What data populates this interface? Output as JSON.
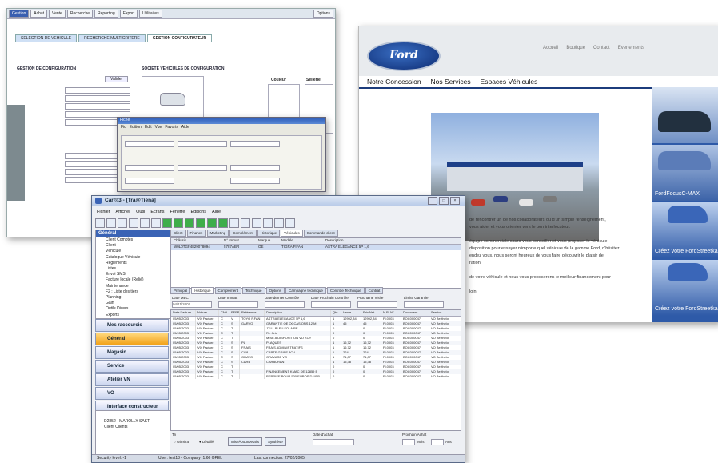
{
  "back_window": {
    "menu": [
      "Gestion",
      "Achat",
      "Vente",
      "Recherche",
      "Reporting",
      "Export",
      "Utilitaires",
      "Options"
    ],
    "tabs": [
      "SELECTION DE VEHICULE",
      "RECHERCHE MULTICRITERE",
      "GESTION CONFIGURATEUR"
    ],
    "sections": {
      "left": "GESTION DE CONFIGURATION",
      "right": "SOCIETE VEHICULES DE CONFIGURATION"
    },
    "columns": [
      "Couleur",
      "Sellerie"
    ],
    "button": "Valider"
  },
  "popup_window": {
    "title": "Fiche",
    "menu": [
      "Fic",
      "Edition",
      "Edit",
      "Vue",
      "Favoris",
      "Aide"
    ]
  },
  "ford_site": {
    "logo": "Ford",
    "top_nav": [
      "Accueil",
      "Boutique",
      "Contact",
      "Evenements"
    ],
    "nav": [
      "Notre Concession",
      "Nos Services",
      "Espaces Véhicules"
    ],
    "side_cards": [
      "",
      "FordFocusC-MAX",
      "Créez votre FordStreetka",
      "Créez votre FordStreetka"
    ],
    "text_lines": [
      "de rencontrer un de nos collaborateurs ou d'un simple renseignement,",
      "vous aider et vous orienter vers le bon interlocuteur.",
      "",
      "équipe commerciale saura vous conseiller et vous proposer le véhicule",
      "disposition pour essayer n'importe quel véhicule de la gamme Ford, n'hésitez",
      "endez vous, nous seront heureux de vous faire découvrir le plaisir de",
      "ration.",
      "",
      "de votre véhicule et nous vous proposerons le meilleur financement pour",
      "",
      "loin."
    ]
  },
  "main_window": {
    "title": "Car@3 - [Tra@Tiena]",
    "menu": [
      "Fichier",
      "Afficher",
      "Outil",
      "Ecrans",
      "Fenêtre",
      "Editions",
      "Aide"
    ],
    "tree_header": "Général",
    "tree_items": [
      "Client Comptes",
      "Client",
      "Véhicule",
      "Catalogue Véhicule",
      "Règlements",
      "Listes",
      "Envoi SMS",
      "Facture locale (Relié)",
      "Maintenance",
      "F2 : Liste des tiers",
      "Planning",
      "Gain",
      "Outils Divers",
      "Exports"
    ],
    "nav_buttons": [
      "Mes raccourcis",
      "Général",
      "Magasin",
      "Service",
      "Atelier VN",
      "VO",
      "Interface constructeur"
    ],
    "nav_bottom_items": [
      "D2852 - MAROLLY SAST",
      "Client Clients"
    ],
    "top_tabs": [
      "Client",
      "Finance",
      "Marketing",
      "Complément",
      "Historique",
      "Véhicules",
      "Commande client"
    ],
    "vehicle_table": {
      "headers": [
        "Châssis",
        "N° Immat",
        "Marque",
        "Modèle",
        "Description"
      ],
      "rows": [
        [
          "W0L0TGF4829078094",
          "5787ABR",
          "OE",
          "TIGRA P.FAN",
          "ASTRA ELEGANCE 5P 1,6"
        ]
      ]
    },
    "mid_tabs": [
      "Principal",
      "Historique",
      "Complément",
      "Technique",
      "Options",
      "Campagne technique",
      "Contrôle Technique",
      "Contrat"
    ],
    "filters": [
      "Date MEC",
      "Date Immat.",
      "Date dernier Contrôle",
      "Date Prochain Contrôle",
      "Prochaine Visite",
      "Limite Garantie"
    ],
    "filter_value": "04/11/2002",
    "hist_table": {
      "headers": [
        "Date Facture",
        "Nature",
        "CNA",
        "PFPP",
        "Référence",
        "Description",
        "Qté",
        "Vente",
        "Prix Net",
        "N.R. N°",
        "Document",
        "Service"
      ],
      "rows": [
        [
          "05/05/2003",
          "VO Facture",
          "C",
          "V",
          "TOYO P.FAN",
          "ASTRA ELEGANCE 5P 1,6",
          "1",
          "12992,34",
          "12992,34",
          "FI.0003",
          "BOC000047",
          "VO Berthelot"
        ],
        [
          "05/05/2003",
          "VO Facture",
          "C",
          "S",
          "GARVO",
          "GARANTIE OE OCCASIONS 12 M",
          "1",
          "45",
          "45",
          "FI.0003",
          "BOC000047",
          "VO Berthelot"
        ],
        [
          "05/05/2003",
          "VO Facture",
          "C",
          "T",
          "",
          "JTU - BLEU FOLAIRE",
          "0",
          "",
          "0",
          "FI.0003",
          "BOC000047",
          "VO Berthelot"
        ],
        [
          "05/05/2003",
          "VO Facture",
          "C",
          "T",
          "",
          "R - Gris",
          "0",
          "",
          "0",
          "FI.0003",
          "BOC000047",
          "VO Berthelot"
        ],
        [
          "05/05/2003",
          "VO Facture",
          "C",
          "T",
          "",
          "MISE A DISPOSITION VO KCY",
          "0",
          "",
          "0",
          "FI.0003",
          "BOC000047",
          "VO Berthelot"
        ],
        [
          "05/05/2003",
          "VO Facture",
          "C",
          "S",
          "PL",
          "PLAQUES",
          "1",
          "16,72",
          "16,72",
          "FI.0003",
          "BOC000047",
          "VO Berthelot"
        ],
        [
          "05/05/2003",
          "VO Facture",
          "C",
          "S",
          "FRAIS",
          "FRAIS ADMINISTRATIFS",
          "1",
          "16,72",
          "16,72",
          "FI.0003",
          "BOC000047",
          "VO Berthelot"
        ],
        [
          "05/05/2003",
          "VO Facture",
          "C",
          "S",
          "CG8",
          "CARTE GRISE 8CV",
          "1",
          "224",
          "224",
          "FI.0003",
          "BOC000047",
          "VO Berthelot"
        ],
        [
          "05/05/2003",
          "VO Facture",
          "C",
          "S",
          "GRAVO",
          "GRAVAGE VO",
          "1",
          "71,07",
          "71,07",
          "FI.0003",
          "BOC000047",
          "VO Berthelot"
        ],
        [
          "05/05/2003",
          "VO Facture",
          "C",
          "S",
          "CARB",
          "CARBURANT",
          "1",
          "15,38",
          "15,38",
          "FI.0003",
          "BOC000047",
          "VO Berthelot"
        ],
        [
          "05/05/2003",
          "VO Facture",
          "C",
          "T",
          "",
          "",
          "0",
          "",
          "0",
          "FI.0003",
          "BOC000047",
          "VO Berthelot"
        ],
        [
          "05/05/2003",
          "VO Facture",
          "C",
          "T",
          "",
          "FINANCEMENT KMAC DE 12859 E",
          "0",
          "",
          "0",
          "FI.0003",
          "BOC000047",
          "VO Berthelot"
        ],
        [
          "05/05/2003",
          "VO Facture",
          "C",
          "T",
          "",
          "REPRISE POUR 500 EUROS D URB",
          "0",
          "",
          "0",
          "FI.0003",
          "BOC000047",
          "VO Berthelot"
        ]
      ]
    },
    "bottom": {
      "tri_label": "Tri",
      "radio_general": "Général",
      "radio_detail": "Détaillé",
      "btn_maj": "MiseÀJourDetails",
      "btn_synthese": "Synthèse",
      "achat_label": "Date d'achat",
      "prochain_label": "Prochain Achat",
      "mois": "Mois",
      "ans": "Ans"
    },
    "status": [
      "Security level: -1",
      "User: test13 - Company: 1.60 OPEL",
      "Last connection: 27/02/2005"
    ]
  }
}
